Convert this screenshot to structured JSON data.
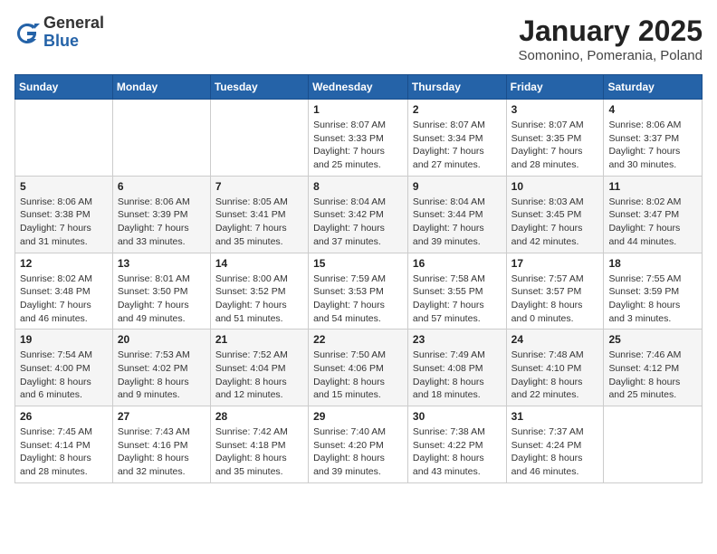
{
  "header": {
    "logo_general": "General",
    "logo_blue": "Blue",
    "month_title": "January 2025",
    "subtitle": "Somonino, Pomerania, Poland"
  },
  "weekdays": [
    "Sunday",
    "Monday",
    "Tuesday",
    "Wednesday",
    "Thursday",
    "Friday",
    "Saturday"
  ],
  "weeks": [
    [
      {
        "day": "",
        "info": ""
      },
      {
        "day": "",
        "info": ""
      },
      {
        "day": "",
        "info": ""
      },
      {
        "day": "1",
        "info": "Sunrise: 8:07 AM\nSunset: 3:33 PM\nDaylight: 7 hours and 25 minutes."
      },
      {
        "day": "2",
        "info": "Sunrise: 8:07 AM\nSunset: 3:34 PM\nDaylight: 7 hours and 27 minutes."
      },
      {
        "day": "3",
        "info": "Sunrise: 8:07 AM\nSunset: 3:35 PM\nDaylight: 7 hours and 28 minutes."
      },
      {
        "day": "4",
        "info": "Sunrise: 8:06 AM\nSunset: 3:37 PM\nDaylight: 7 hours and 30 minutes."
      }
    ],
    [
      {
        "day": "5",
        "info": "Sunrise: 8:06 AM\nSunset: 3:38 PM\nDaylight: 7 hours and 31 minutes."
      },
      {
        "day": "6",
        "info": "Sunrise: 8:06 AM\nSunset: 3:39 PM\nDaylight: 7 hours and 33 minutes."
      },
      {
        "day": "7",
        "info": "Sunrise: 8:05 AM\nSunset: 3:41 PM\nDaylight: 7 hours and 35 minutes."
      },
      {
        "day": "8",
        "info": "Sunrise: 8:04 AM\nSunset: 3:42 PM\nDaylight: 7 hours and 37 minutes."
      },
      {
        "day": "9",
        "info": "Sunrise: 8:04 AM\nSunset: 3:44 PM\nDaylight: 7 hours and 39 minutes."
      },
      {
        "day": "10",
        "info": "Sunrise: 8:03 AM\nSunset: 3:45 PM\nDaylight: 7 hours and 42 minutes."
      },
      {
        "day": "11",
        "info": "Sunrise: 8:02 AM\nSunset: 3:47 PM\nDaylight: 7 hours and 44 minutes."
      }
    ],
    [
      {
        "day": "12",
        "info": "Sunrise: 8:02 AM\nSunset: 3:48 PM\nDaylight: 7 hours and 46 minutes."
      },
      {
        "day": "13",
        "info": "Sunrise: 8:01 AM\nSunset: 3:50 PM\nDaylight: 7 hours and 49 minutes."
      },
      {
        "day": "14",
        "info": "Sunrise: 8:00 AM\nSunset: 3:52 PM\nDaylight: 7 hours and 51 minutes."
      },
      {
        "day": "15",
        "info": "Sunrise: 7:59 AM\nSunset: 3:53 PM\nDaylight: 7 hours and 54 minutes."
      },
      {
        "day": "16",
        "info": "Sunrise: 7:58 AM\nSunset: 3:55 PM\nDaylight: 7 hours and 57 minutes."
      },
      {
        "day": "17",
        "info": "Sunrise: 7:57 AM\nSunset: 3:57 PM\nDaylight: 8 hours and 0 minutes."
      },
      {
        "day": "18",
        "info": "Sunrise: 7:55 AM\nSunset: 3:59 PM\nDaylight: 8 hours and 3 minutes."
      }
    ],
    [
      {
        "day": "19",
        "info": "Sunrise: 7:54 AM\nSunset: 4:00 PM\nDaylight: 8 hours and 6 minutes."
      },
      {
        "day": "20",
        "info": "Sunrise: 7:53 AM\nSunset: 4:02 PM\nDaylight: 8 hours and 9 minutes."
      },
      {
        "day": "21",
        "info": "Sunrise: 7:52 AM\nSunset: 4:04 PM\nDaylight: 8 hours and 12 minutes."
      },
      {
        "day": "22",
        "info": "Sunrise: 7:50 AM\nSunset: 4:06 PM\nDaylight: 8 hours and 15 minutes."
      },
      {
        "day": "23",
        "info": "Sunrise: 7:49 AM\nSunset: 4:08 PM\nDaylight: 8 hours and 18 minutes."
      },
      {
        "day": "24",
        "info": "Sunrise: 7:48 AM\nSunset: 4:10 PM\nDaylight: 8 hours and 22 minutes."
      },
      {
        "day": "25",
        "info": "Sunrise: 7:46 AM\nSunset: 4:12 PM\nDaylight: 8 hours and 25 minutes."
      }
    ],
    [
      {
        "day": "26",
        "info": "Sunrise: 7:45 AM\nSunset: 4:14 PM\nDaylight: 8 hours and 28 minutes."
      },
      {
        "day": "27",
        "info": "Sunrise: 7:43 AM\nSunset: 4:16 PM\nDaylight: 8 hours and 32 minutes."
      },
      {
        "day": "28",
        "info": "Sunrise: 7:42 AM\nSunset: 4:18 PM\nDaylight: 8 hours and 35 minutes."
      },
      {
        "day": "29",
        "info": "Sunrise: 7:40 AM\nSunset: 4:20 PM\nDaylight: 8 hours and 39 minutes."
      },
      {
        "day": "30",
        "info": "Sunrise: 7:38 AM\nSunset: 4:22 PM\nDaylight: 8 hours and 43 minutes."
      },
      {
        "day": "31",
        "info": "Sunrise: 7:37 AM\nSunset: 4:24 PM\nDaylight: 8 hours and 46 minutes."
      },
      {
        "day": "",
        "info": ""
      }
    ]
  ]
}
